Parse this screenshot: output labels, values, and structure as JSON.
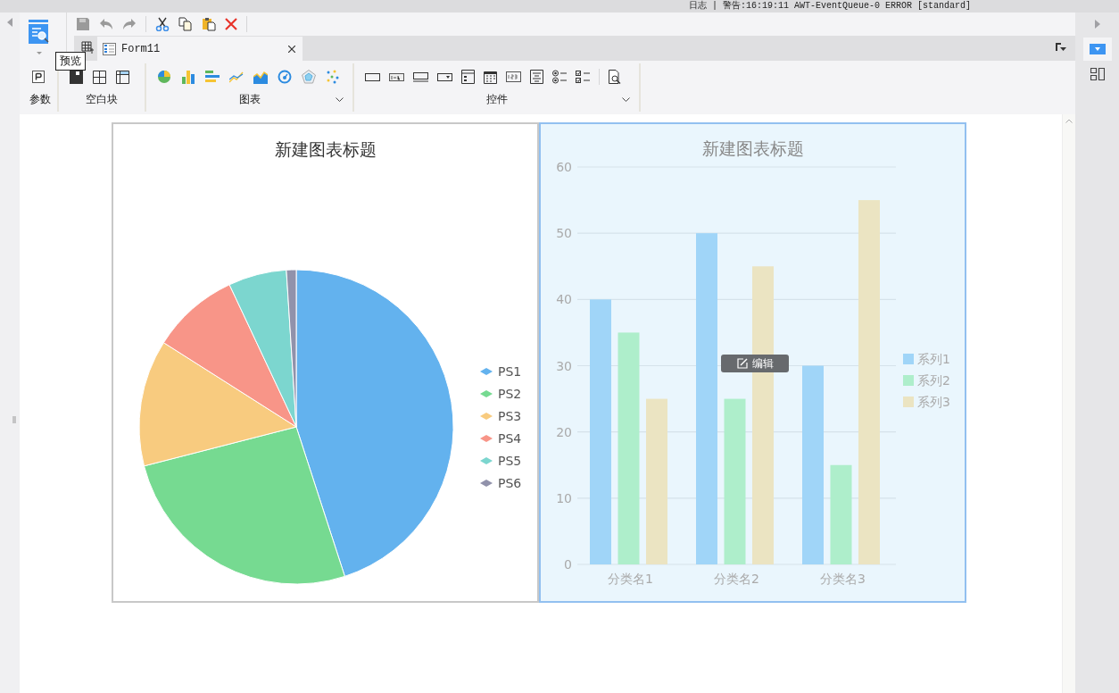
{
  "log_bar": {
    "text": "日志 | 警告:16:19:11 AWT-EventQueue-0 ERROR [standard]"
  },
  "tooltip": {
    "text": "预览"
  },
  "tabs": [
    {
      "label": "Form11",
      "selected": true
    }
  ],
  "ribbon_groups": [
    {
      "label": "参数",
      "has_menu": false
    },
    {
      "label": "空白块",
      "has_menu": false
    },
    {
      "label": "图表",
      "has_menu": true
    },
    {
      "label": "控件",
      "has_menu": true
    }
  ],
  "pie_card": {
    "chart_data": {
      "type": "pie",
      "title": "新建图表标题",
      "legend": true,
      "categories": [
        "PS1",
        "PS2",
        "PS3",
        "PS4",
        "PS5",
        "PS6"
      ],
      "values": [
        45,
        26,
        13,
        9,
        6,
        1
      ],
      "colors": [
        "#63b2ee",
        "#76da91",
        "#f8cb7f",
        "#f89588",
        "#7cd6cf",
        "#9192ab"
      ]
    }
  },
  "bar_card": {
    "selected": true,
    "edit_button": "编辑",
    "chart_data": {
      "type": "bar",
      "title": "新建图表标题",
      "legend": true,
      "grid": true,
      "categories": [
        "分类名1",
        "分类名2",
        "分类名3"
      ],
      "series": [
        {
          "name": "系列1",
          "color": "#a0d5f8",
          "values": [
            40,
            50,
            30
          ]
        },
        {
          "name": "系列2",
          "color": "#aeeecb",
          "values": [
            35,
            25,
            15
          ]
        },
        {
          "name": "系列3",
          "color": "#ebe4c2",
          "values": [
            25,
            45,
            55
          ]
        }
      ],
      "ylim": [
        0,
        60
      ],
      "yticks": [
        0,
        10,
        20,
        30,
        40,
        50,
        60
      ]
    }
  }
}
